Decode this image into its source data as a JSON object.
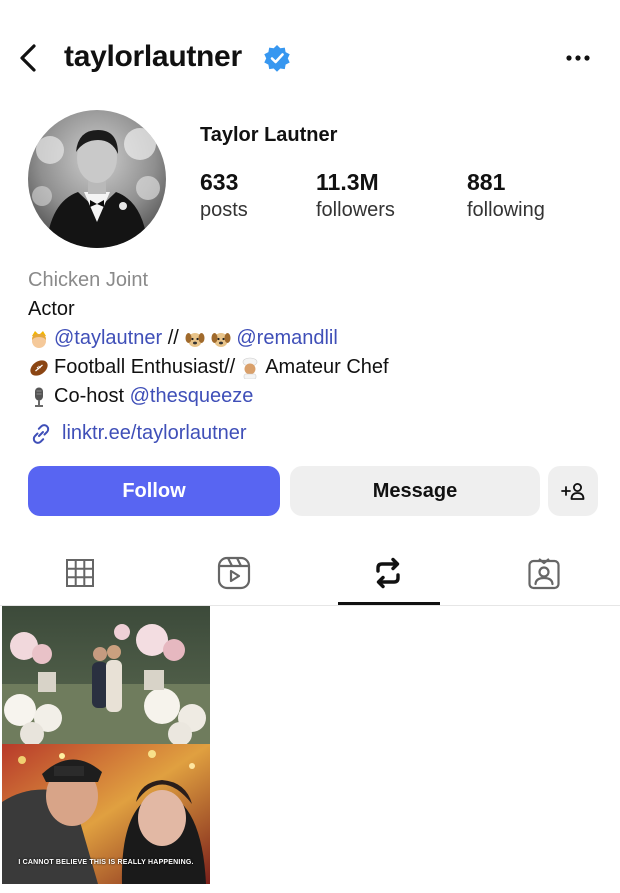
{
  "header": {
    "username": "taylorlautner",
    "verified": true,
    "back_icon": "chevron-left-icon",
    "more_icon": "more-horizontal-icon",
    "verified_color": "#3797f0"
  },
  "profile": {
    "display_name": "Taylor Lautner",
    "stats": {
      "posts_count": "633",
      "posts_label": "posts",
      "followers_count": "11.3M",
      "followers_label": "followers",
      "following_count": "881",
      "following_label": "following"
    },
    "bio": {
      "category": "Chicken Joint",
      "title": "Actor",
      "line1_mention1": "@taylautner",
      "line1_separator": " // ",
      "line1_mention2": "@remandlil",
      "line2_text1": "Football Enthusiast//",
      "line2_text2": "Amateur Chef",
      "line3_text": "Co-host ",
      "line3_mention": "@thesqueeze",
      "link": "linktr.ee/taylorlautner"
    }
  },
  "actions": {
    "follow_label": "Follow",
    "message_label": "Message",
    "add_user_icon": "add-user-icon",
    "follow_color": "#5865f2"
  },
  "tabs": [
    {
      "name": "grid",
      "icon": "grid-icon",
      "active": false
    },
    {
      "name": "reels",
      "icon": "reels-icon",
      "active": false
    },
    {
      "name": "reposts",
      "icon": "repost-icon",
      "active": true
    },
    {
      "name": "tagged",
      "icon": "tagged-icon",
      "active": false
    }
  ],
  "posts": [
    {
      "caption": "I CANNOT BELIEVE THIS IS REALLY HAPPENING."
    }
  ]
}
